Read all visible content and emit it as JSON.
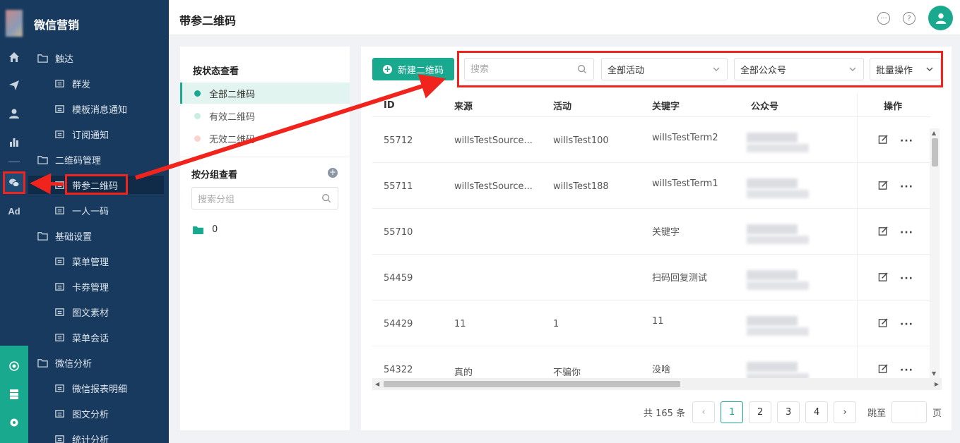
{
  "app": {
    "brand": "微信营销"
  },
  "header": {
    "title": "带参二维码"
  },
  "rail": {
    "icons": [
      "home-icon",
      "send-icon",
      "user-icon",
      "chart-icon",
      "wechat-icon",
      "ad-icon",
      "hub-icon",
      "server-icon",
      "gear-icon"
    ],
    "ad_label": "Ad"
  },
  "sidebar": {
    "items": [
      {
        "label": "触达",
        "level": 1
      },
      {
        "label": "群发",
        "level": 2
      },
      {
        "label": "模板消息通知",
        "level": 2
      },
      {
        "label": "订阅通知",
        "level": 2
      },
      {
        "label": "二维码管理",
        "level": 1
      },
      {
        "label": "带参二维码",
        "level": 2,
        "active": true
      },
      {
        "label": "一人一码",
        "level": 2
      },
      {
        "label": "基础设置",
        "level": 1
      },
      {
        "label": "菜单管理",
        "level": 2
      },
      {
        "label": "卡券管理",
        "level": 2
      },
      {
        "label": "图文素材",
        "level": 2
      },
      {
        "label": "菜单会话",
        "level": 2
      },
      {
        "label": "微信分析",
        "level": 1
      },
      {
        "label": "微信报表明细",
        "level": 2
      },
      {
        "label": "图文分析",
        "level": 2
      },
      {
        "label": "统计分析",
        "level": 2
      }
    ]
  },
  "filter_panel": {
    "status_title": "按状态查看",
    "statuses": [
      {
        "label": "全部二维码",
        "color": "#19a98e",
        "selected": true
      },
      {
        "label": "有效二维码",
        "color": "#c9eddf",
        "selected": false
      },
      {
        "label": "无效二维码",
        "color": "#f9d3cd",
        "selected": false
      }
    ],
    "group_title": "按分组查看",
    "group_search_placeholder": "搜索分组",
    "groups": [
      {
        "label": "0"
      }
    ]
  },
  "toolbar": {
    "new_button": "新建二维码",
    "search_placeholder": "搜索",
    "activity_select": "全部活动",
    "account_select": "全部公众号",
    "batch_button": "批量操作"
  },
  "table": {
    "columns": [
      "ID",
      "来源",
      "活动",
      "关键字",
      "公众号",
      "操作"
    ],
    "rows": [
      {
        "id": "55712",
        "source": "willsTestSource...",
        "activity": "willsTest100",
        "keyword": "willsTestTerm2"
      },
      {
        "id": "55711",
        "source": "willsTestSource...",
        "activity": "willsTest188",
        "keyword": "willsTestTerm1"
      },
      {
        "id": "55710",
        "source": "",
        "activity": "",
        "keyword": "关键字"
      },
      {
        "id": "54459",
        "source": "",
        "activity": "",
        "keyword": "扫码回复测试"
      },
      {
        "id": "54429",
        "source": "11",
        "activity": "1",
        "keyword": "11"
      },
      {
        "id": "54322",
        "source": "真的",
        "activity": "不骗你",
        "keyword": "没啥"
      }
    ]
  },
  "pagination": {
    "total": "共 165 条",
    "pages": [
      "1",
      "2",
      "3",
      "4"
    ],
    "current": "1",
    "goto_label": "跳至",
    "page_unit": "页"
  },
  "colors": {
    "primary": "#19a98e",
    "sidebar": "#173a5e",
    "highlight": "#f0241c"
  }
}
